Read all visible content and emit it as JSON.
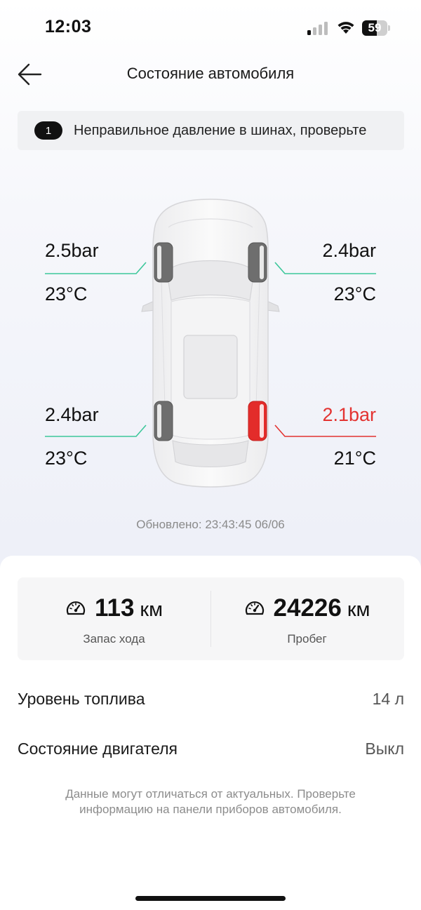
{
  "status_bar": {
    "time": "12:03",
    "battery_level": "59",
    "battery_fraction": 0.59
  },
  "header": {
    "title": "Состояние автомобиля"
  },
  "alert": {
    "count": "1",
    "text": "Неправильное давление в шинах, проверьте"
  },
  "tires": {
    "front_left": {
      "pressure": "2.5bar",
      "temperature": "23°C",
      "warning": false
    },
    "front_right": {
      "pressure": "2.4bar",
      "temperature": "23°C",
      "warning": false
    },
    "rear_left": {
      "pressure": "2.4bar",
      "temperature": "23°C",
      "warning": false
    },
    "rear_right": {
      "pressure": "2.1bar",
      "temperature": "21°C",
      "warning": true
    }
  },
  "updated": "Обновлено: 23:43:45 06/06",
  "stats": {
    "range": {
      "value": "113",
      "unit": "км",
      "label": "Запас хода",
      "icon": "speedometer-icon"
    },
    "odometer": {
      "value": "24226",
      "unit": "км",
      "label": "Пробег",
      "icon": "speedometer-icon"
    }
  },
  "info": {
    "fuel": {
      "label": "Уровень топлива",
      "value": "14 л"
    },
    "engine": {
      "label": "Состояние двигателя",
      "value": "Выкл"
    }
  },
  "disclaimer": "Данные могут отличаться от актуальных. Проверьте информацию на панели приборов автомобиля.",
  "colors": {
    "ok_line": "#3cc79a",
    "warning": "#e33331",
    "tire": "#6e6e6e"
  }
}
